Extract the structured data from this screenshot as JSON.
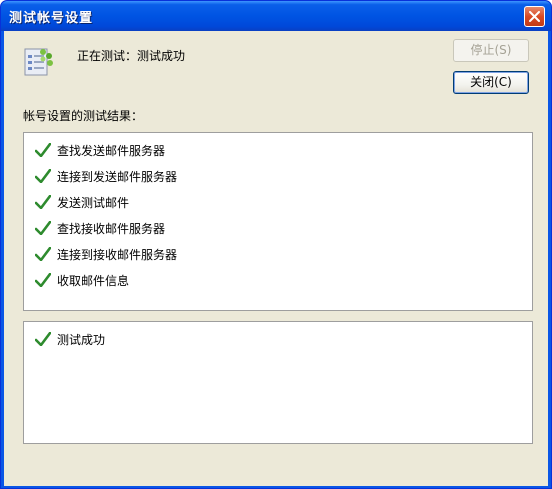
{
  "window": {
    "title": "测试帐号设置",
    "status": "正在测试：测试成功",
    "buttons": {
      "stop": "停止(S)",
      "close": "关闭(C)"
    },
    "section_label": "帐号设置的测试结果：",
    "steps": [
      "查找发送邮件服务器",
      "连接到发送邮件服务器",
      "发送测试邮件",
      "查找接收邮件服务器",
      "连接到接收邮件服务器",
      "收取邮件信息"
    ],
    "result": "测试成功"
  },
  "icons": {
    "check": "check-icon",
    "app": "account-settings-icon",
    "close": "close-icon"
  },
  "colors": {
    "titlebar": "#0054e3",
    "check": "#2e8b2e",
    "dialog_bg": "#ece9d8"
  }
}
